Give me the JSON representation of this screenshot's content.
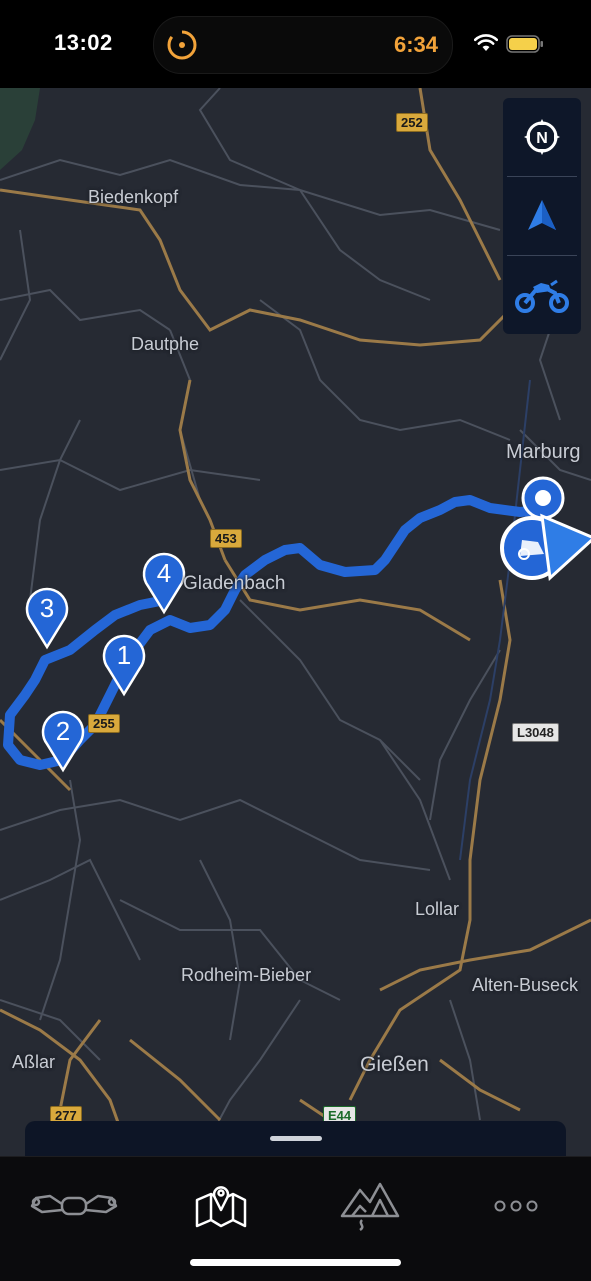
{
  "status_bar": {
    "time": "13:02",
    "timer": "6:34"
  },
  "map": {
    "places": [
      {
        "id": "biedenkopf",
        "label": "Biedenkopf"
      },
      {
        "id": "dautphe",
        "label": "Dautphe"
      },
      {
        "id": "marburg",
        "label": "Marburg"
      },
      {
        "id": "gladenbach",
        "label": "Gladenbach"
      },
      {
        "id": "lollar",
        "label": "Lollar"
      },
      {
        "id": "rodheim",
        "label": "Rodheim-Bieber"
      },
      {
        "id": "alten",
        "label": "Alten-Buseck"
      },
      {
        "id": "asslar",
        "label": "Aßlar"
      },
      {
        "id": "giessen",
        "label": "Gießen"
      }
    ],
    "road_shields": [
      {
        "id": "b252",
        "label": "252"
      },
      {
        "id": "b453",
        "label": "453"
      },
      {
        "id": "b255",
        "label": "255"
      },
      {
        "id": "l3048",
        "label": "L3048"
      },
      {
        "id": "b277",
        "label": "277"
      },
      {
        "id": "e44",
        "label": "E44"
      }
    ],
    "waypoints": [
      "1",
      "2",
      "3",
      "4"
    ]
  },
  "map_controls": [
    "compass-north-button",
    "navigation-arrow-button",
    "motorcycle-mode-button"
  ],
  "tabs": [
    {
      "id": "ride",
      "icon": "motorcycle-handlebar-icon",
      "active": false
    },
    {
      "id": "map",
      "icon": "map-pin-icon",
      "active": true
    },
    {
      "id": "explore",
      "icon": "mountains-icon",
      "active": false
    },
    {
      "id": "more",
      "icon": "more-dots-icon",
      "active": false
    }
  ],
  "colors": {
    "route": "#2466d6",
    "accent_orange": "#f2a33a",
    "map_bg": "#262a33"
  }
}
